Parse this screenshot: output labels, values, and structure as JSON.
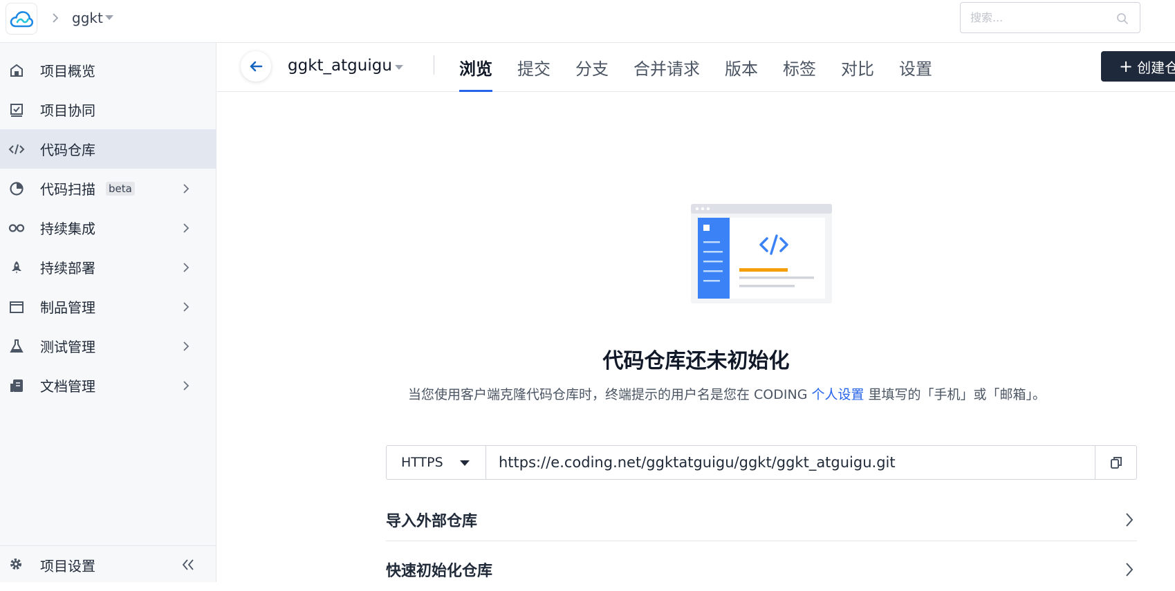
{
  "topbar": {
    "project": "ggkt",
    "search_placeholder": "搜索..."
  },
  "sidebar": {
    "items": [
      {
        "label": "项目概览",
        "icon": "home-icon"
      },
      {
        "label": "项目协同",
        "icon": "checkbox-icon"
      },
      {
        "label": "代码仓库",
        "icon": "code-icon",
        "active": true
      },
      {
        "label": "代码扫描",
        "icon": "scan-icon",
        "badge": "beta"
      },
      {
        "label": "持续集成",
        "icon": "infinity-icon"
      },
      {
        "label": "持续部署",
        "icon": "rocket-icon"
      },
      {
        "label": "制品管理",
        "icon": "package-icon"
      },
      {
        "label": "测试管理",
        "icon": "flask-icon"
      },
      {
        "label": "文档管理",
        "icon": "book-icon"
      }
    ],
    "footer": {
      "label": "项目设置",
      "icon": "gear-icon"
    }
  },
  "repo": {
    "name": "ggkt_atguigu",
    "tabs": [
      "浏览",
      "提交",
      "分支",
      "合并请求",
      "版本",
      "标签",
      "对比",
      "设置"
    ],
    "active_tab": "浏览",
    "create_label": "创建仓"
  },
  "empty_state": {
    "title": "代码仓库还未初始化",
    "desc_before": "当您使用客户端克隆代码仓库时，终端提示的用户名是您在 CODING ",
    "desc_link": "个人设置",
    "desc_after": " 里填写的「手机」或「邮箱」。"
  },
  "clone": {
    "protocol": "HTTPS",
    "url": "https://e.coding.net/ggktatguigu/ggkt/ggkt_atguigu.git"
  },
  "sections": {
    "import_label": "导入外部仓库",
    "quick_init_label": "快速初始化仓库"
  },
  "colors": {
    "accent": "#2563eb",
    "sidebar_bg": "#f7f8fa",
    "active_bg": "#e3e7ef",
    "create_btn": "#1e293b"
  }
}
